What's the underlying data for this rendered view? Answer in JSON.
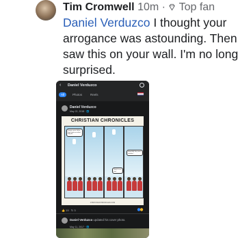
{
  "comment": {
    "author": "Tim Cromwell",
    "time": "10m",
    "separator": "·",
    "badge": "Top fan",
    "mention": "Daniel Verduzco",
    "text": " I thought your arrogance was astounding. Then saw this on your wall. I'm no long surprised."
  },
  "phone": {
    "back_icon": "back-arrow-icon",
    "title": "Daniel Verduzco",
    "tabs": [
      "All",
      "Photos",
      "Reels"
    ],
    "post": {
      "name": "Daniel Verduzco",
      "date": "May 22, 2018 · 🌐",
      "comic_title": "CHRISTIAN CHRONICLES",
      "bubble1": "Forgive your father, they know not what they do",
      "bubble2": "Glad it's our turn!",
      "bubble3": "Hopefully they won't mistake...",
      "comic_footer": "CHRISTIANCHRONICLES.COM"
    },
    "reactions": {
      "likes": "19",
      "shares": "3"
    },
    "post2": {
      "name": "Daniel Verduzco",
      "action": " updated his cover photo.",
      "date": "May 11, 2017 · 🌐"
    }
  },
  "colors": {
    "mention": "#2a5fb8",
    "phone_bg": "#18191a",
    "active_tab": "#2d88ff"
  }
}
